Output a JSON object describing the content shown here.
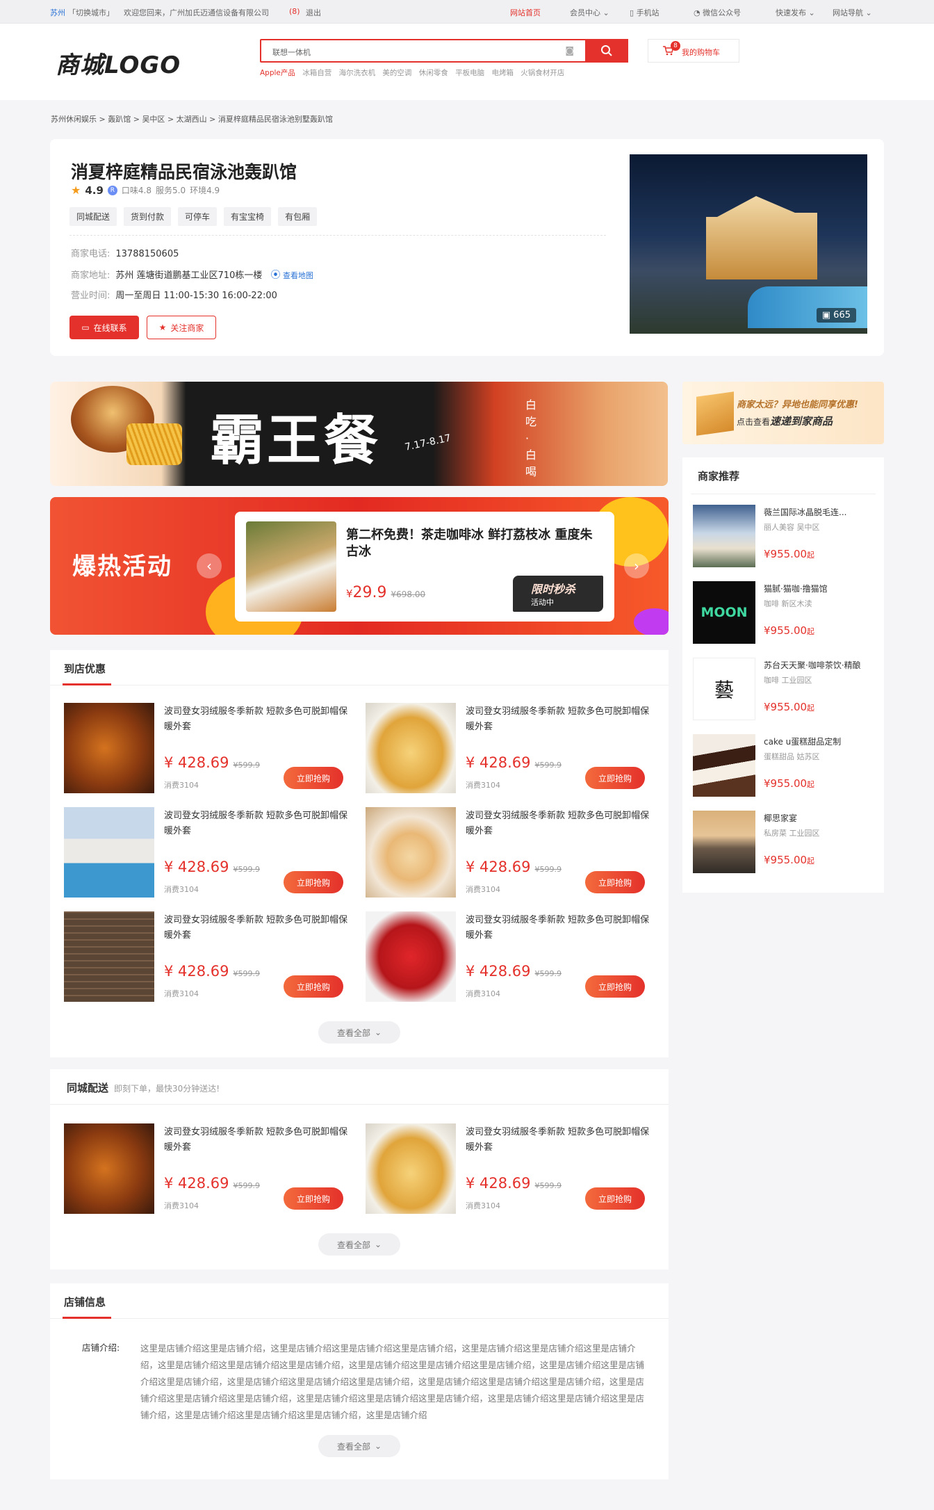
{
  "topbar": {
    "city": "苏州",
    "switch_city": "「切换城市」",
    "welcome": "欢迎您回来，广州加氏迈通信设备有限公司",
    "msg_count": "(8)",
    "logout": "退出",
    "home": "网站首页",
    "member": "会员中心",
    "mobile": "手机站",
    "wechat": "微信公众号",
    "publish": "快速发布",
    "nav": "网站导航"
  },
  "header": {
    "logo": "商城LOGO",
    "search_value": "联想一体机",
    "cart_label": "我的购物车",
    "cart_count": "8",
    "hot_first": "Apple产品",
    "hot_words": [
      "冰箱自营",
      "海尔洗衣机",
      "美的空调",
      "休闲零食",
      "平板电脑",
      "电烤箱",
      "火锅食材开店"
    ]
  },
  "breadcrumb": [
    "苏州休闲娱乐",
    "轰趴馆",
    "吴中区",
    "太湖西山",
    "消夏梓庭精品民宿泳池别墅轰趴馆"
  ],
  "breadcrumb_sep": ">",
  "store": {
    "name": "消夏梓庭精品民宿泳池轰趴馆",
    "score": "4.9",
    "taste": "口味4.8",
    "service": "服务5.0",
    "env": "环境4.9",
    "tags": [
      "同城配送",
      "货到付款",
      "可停车",
      "有宝宝椅",
      "有包厢"
    ],
    "phone_label": "商家电话:",
    "phone": "13788150605",
    "addr_label": "商家地址:",
    "addr": "苏州 莲塘街道鹏基工业区710栋一楼",
    "map_link": "查看地图",
    "hours_label": "营业时间:",
    "hours": "周一至周日 11:00-15:30 16:00-22:00",
    "contact_btn": "在线联系",
    "follow_btn": "关注商家",
    "photo_count": "665"
  },
  "banner1": {
    "title": "霸王餐",
    "date": "7.17-8.17",
    "side": "白吃·白喝"
  },
  "hot_activity": {
    "title": "爆热活动",
    "deal_name": "第二杯免费！茶走咖啡冰 鲜打荔枝冰 重度朱古冰",
    "currency": "¥",
    "price": "29.9",
    "orig_price": "¥698.00",
    "flash_title": "限时秒杀",
    "flash_status": "活动中"
  },
  "promo": {
    "line1": "商家太远？异地也能同享优惠!",
    "line2_pre": "点击查看",
    "line2_bold": "速递到家商品"
  },
  "recommend": {
    "title": "商家推荐",
    "items": [
      {
        "name": "薇兰国际冰晶脱毛连...",
        "sub": "丽人美容  吴中区",
        "price": "¥955.00",
        "unit": "起"
      },
      {
        "name": "猫腻·猫咖·撸猫馆",
        "sub": "咖啡  新区木渎",
        "price": "¥955.00",
        "unit": "起",
        "logo_text": "MOON"
      },
      {
        "name": "苏台天天聚·咖啡茶饮·精酿",
        "sub": "咖啡  工业园区",
        "price": "¥955.00",
        "unit": "起",
        "logo_text": "藝"
      },
      {
        "name": "cake u蛋糕甜品定制",
        "sub": "蛋糕甜品  姑苏区",
        "price": "¥955.00",
        "unit": "起"
      },
      {
        "name": "椰思家宴",
        "sub": "私房菜  工业园区",
        "price": "¥955.00",
        "unit": "起"
      }
    ]
  },
  "coupons": {
    "title": "到店优惠",
    "items": [
      {
        "title": "波司登女羽绒服冬季新款 短款多色可脱卸帽保暖外套",
        "price": "¥ 428.69",
        "orig": "¥599.9",
        "sold": "消费3104",
        "buy": "立即抢购"
      },
      {
        "title": "波司登女羽绒服冬季新款 短款多色可脱卸帽保暖外套",
        "price": "¥ 428.69",
        "orig": "¥599.9",
        "sold": "消费3104",
        "buy": "立即抢购"
      },
      {
        "title": "波司登女羽绒服冬季新款 短款多色可脱卸帽保暖外套",
        "price": "¥ 428.69",
        "orig": "¥599.9",
        "sold": "消费3104",
        "buy": "立即抢购"
      },
      {
        "title": "波司登女羽绒服冬季新款 短款多色可脱卸帽保暖外套",
        "price": "¥ 428.69",
        "orig": "¥599.9",
        "sold": "消费3104",
        "buy": "立即抢购"
      },
      {
        "title": "波司登女羽绒服冬季新款 短款多色可脱卸帽保暖外套",
        "price": "¥ 428.69",
        "orig": "¥599.9",
        "sold": "消费3104",
        "buy": "立即抢购"
      },
      {
        "title": "波司登女羽绒服冬季新款 短款多色可脱卸帽保暖外套",
        "price": "¥ 428.69",
        "orig": "¥599.9",
        "sold": "消费3104",
        "buy": "立即抢购"
      }
    ],
    "more": "查看全部"
  },
  "delivery": {
    "title": "同城配送",
    "subtitle": "即刻下单，最快30分钟送达!",
    "items": [
      {
        "title": "波司登女羽绒服冬季新款 短款多色可脱卸帽保暖外套",
        "price": "¥ 428.69",
        "orig": "¥599.9",
        "sold": "消费3104",
        "buy": "立即抢购"
      },
      {
        "title": "波司登女羽绒服冬季新款 短款多色可脱卸帽保暖外套",
        "price": "¥ 428.69",
        "orig": "¥599.9",
        "sold": "消费3104",
        "buy": "立即抢购"
      }
    ],
    "more": "查看全部"
  },
  "shopinfo": {
    "title": "店铺信息",
    "label": "店铺介绍:",
    "text": "这里是店铺介绍这里是店铺介绍，这里是店铺介绍这里是店铺介绍这里是店铺介绍，这里是店铺介绍这里是店铺介绍这里是店铺介绍，这里是店铺介绍这里是店铺介绍这里是店铺介绍，这里是店铺介绍这里是店铺介绍这里是店铺介绍，这里是店铺介绍这里是店铺介绍这里是店铺介绍，这里是店铺介绍这里是店铺介绍这里是店铺介绍，这里是店铺介绍这里是店铺介绍这里是店铺介绍，这里是店铺介绍这里是店铺介绍这里是店铺介绍，这里是店铺介绍这里是店铺介绍这里是店铺介绍，这里是店铺介绍这里是店铺介绍这里是店铺介绍，这里是店铺介绍这里是店铺介绍这里是店铺介绍，这里是店铺介绍",
    "more": "查看全部"
  },
  "colors": {
    "accent": "#e4312b",
    "link": "#2a72d6",
    "bg": "#f5f5f7"
  }
}
